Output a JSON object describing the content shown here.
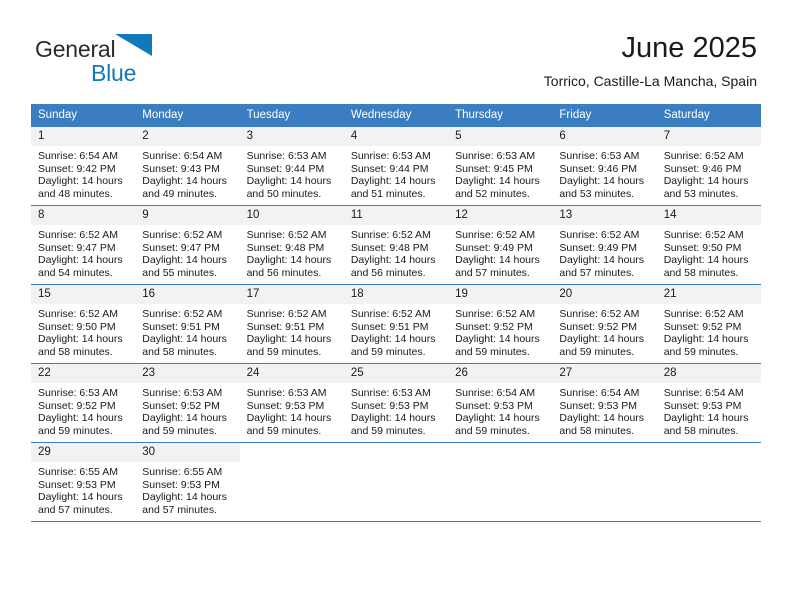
{
  "brand": {
    "name_part1": "General",
    "name_part2": "Blue",
    "triangle_icon": "brand-triangle-icon",
    "color_dark": "#2b2b2b",
    "color_blue": "#1278be"
  },
  "header": {
    "title": "June 2025",
    "subtitle": "Torrico, Castille-La Mancha, Spain"
  },
  "theme": {
    "header_bg": "#3a7dc0",
    "daynum_bg": "#f2f2f2",
    "text": "#1a1a1a"
  },
  "weekday_headers": [
    "Sunday",
    "Monday",
    "Tuesday",
    "Wednesday",
    "Thursday",
    "Friday",
    "Saturday"
  ],
  "weeks": [
    [
      {
        "day": "1",
        "sunrise": "Sunrise: 6:54 AM",
        "sunset": "Sunset: 9:42 PM",
        "daylight1": "Daylight: 14 hours",
        "daylight2": "and 48 minutes."
      },
      {
        "day": "2",
        "sunrise": "Sunrise: 6:54 AM",
        "sunset": "Sunset: 9:43 PM",
        "daylight1": "Daylight: 14 hours",
        "daylight2": "and 49 minutes."
      },
      {
        "day": "3",
        "sunrise": "Sunrise: 6:53 AM",
        "sunset": "Sunset: 9:44 PM",
        "daylight1": "Daylight: 14 hours",
        "daylight2": "and 50 minutes."
      },
      {
        "day": "4",
        "sunrise": "Sunrise: 6:53 AM",
        "sunset": "Sunset: 9:44 PM",
        "daylight1": "Daylight: 14 hours",
        "daylight2": "and 51 minutes."
      },
      {
        "day": "5",
        "sunrise": "Sunrise: 6:53 AM",
        "sunset": "Sunset: 9:45 PM",
        "daylight1": "Daylight: 14 hours",
        "daylight2": "and 52 minutes."
      },
      {
        "day": "6",
        "sunrise": "Sunrise: 6:53 AM",
        "sunset": "Sunset: 9:46 PM",
        "daylight1": "Daylight: 14 hours",
        "daylight2": "and 53 minutes."
      },
      {
        "day": "7",
        "sunrise": "Sunrise: 6:52 AM",
        "sunset": "Sunset: 9:46 PM",
        "daylight1": "Daylight: 14 hours",
        "daylight2": "and 53 minutes."
      }
    ],
    [
      {
        "day": "8",
        "sunrise": "Sunrise: 6:52 AM",
        "sunset": "Sunset: 9:47 PM",
        "daylight1": "Daylight: 14 hours",
        "daylight2": "and 54 minutes."
      },
      {
        "day": "9",
        "sunrise": "Sunrise: 6:52 AM",
        "sunset": "Sunset: 9:47 PM",
        "daylight1": "Daylight: 14 hours",
        "daylight2": "and 55 minutes."
      },
      {
        "day": "10",
        "sunrise": "Sunrise: 6:52 AM",
        "sunset": "Sunset: 9:48 PM",
        "daylight1": "Daylight: 14 hours",
        "daylight2": "and 56 minutes."
      },
      {
        "day": "11",
        "sunrise": "Sunrise: 6:52 AM",
        "sunset": "Sunset: 9:48 PM",
        "daylight1": "Daylight: 14 hours",
        "daylight2": "and 56 minutes."
      },
      {
        "day": "12",
        "sunrise": "Sunrise: 6:52 AM",
        "sunset": "Sunset: 9:49 PM",
        "daylight1": "Daylight: 14 hours",
        "daylight2": "and 57 minutes."
      },
      {
        "day": "13",
        "sunrise": "Sunrise: 6:52 AM",
        "sunset": "Sunset: 9:49 PM",
        "daylight1": "Daylight: 14 hours",
        "daylight2": "and 57 minutes."
      },
      {
        "day": "14",
        "sunrise": "Sunrise: 6:52 AM",
        "sunset": "Sunset: 9:50 PM",
        "daylight1": "Daylight: 14 hours",
        "daylight2": "and 58 minutes."
      }
    ],
    [
      {
        "day": "15",
        "sunrise": "Sunrise: 6:52 AM",
        "sunset": "Sunset: 9:50 PM",
        "daylight1": "Daylight: 14 hours",
        "daylight2": "and 58 minutes."
      },
      {
        "day": "16",
        "sunrise": "Sunrise: 6:52 AM",
        "sunset": "Sunset: 9:51 PM",
        "daylight1": "Daylight: 14 hours",
        "daylight2": "and 58 minutes."
      },
      {
        "day": "17",
        "sunrise": "Sunrise: 6:52 AM",
        "sunset": "Sunset: 9:51 PM",
        "daylight1": "Daylight: 14 hours",
        "daylight2": "and 59 minutes."
      },
      {
        "day": "18",
        "sunrise": "Sunrise: 6:52 AM",
        "sunset": "Sunset: 9:51 PM",
        "daylight1": "Daylight: 14 hours",
        "daylight2": "and 59 minutes."
      },
      {
        "day": "19",
        "sunrise": "Sunrise: 6:52 AM",
        "sunset": "Sunset: 9:52 PM",
        "daylight1": "Daylight: 14 hours",
        "daylight2": "and 59 minutes."
      },
      {
        "day": "20",
        "sunrise": "Sunrise: 6:52 AM",
        "sunset": "Sunset: 9:52 PM",
        "daylight1": "Daylight: 14 hours",
        "daylight2": "and 59 minutes."
      },
      {
        "day": "21",
        "sunrise": "Sunrise: 6:52 AM",
        "sunset": "Sunset: 9:52 PM",
        "daylight1": "Daylight: 14 hours",
        "daylight2": "and 59 minutes."
      }
    ],
    [
      {
        "day": "22",
        "sunrise": "Sunrise: 6:53 AM",
        "sunset": "Sunset: 9:52 PM",
        "daylight1": "Daylight: 14 hours",
        "daylight2": "and 59 minutes."
      },
      {
        "day": "23",
        "sunrise": "Sunrise: 6:53 AM",
        "sunset": "Sunset: 9:52 PM",
        "daylight1": "Daylight: 14 hours",
        "daylight2": "and 59 minutes."
      },
      {
        "day": "24",
        "sunrise": "Sunrise: 6:53 AM",
        "sunset": "Sunset: 9:53 PM",
        "daylight1": "Daylight: 14 hours",
        "daylight2": "and 59 minutes."
      },
      {
        "day": "25",
        "sunrise": "Sunrise: 6:53 AM",
        "sunset": "Sunset: 9:53 PM",
        "daylight1": "Daylight: 14 hours",
        "daylight2": "and 59 minutes."
      },
      {
        "day": "26",
        "sunrise": "Sunrise: 6:54 AM",
        "sunset": "Sunset: 9:53 PM",
        "daylight1": "Daylight: 14 hours",
        "daylight2": "and 59 minutes."
      },
      {
        "day": "27",
        "sunrise": "Sunrise: 6:54 AM",
        "sunset": "Sunset: 9:53 PM",
        "daylight1": "Daylight: 14 hours",
        "daylight2": "and 58 minutes."
      },
      {
        "day": "28",
        "sunrise": "Sunrise: 6:54 AM",
        "sunset": "Sunset: 9:53 PM",
        "daylight1": "Daylight: 14 hours",
        "daylight2": "and 58 minutes."
      }
    ],
    [
      {
        "day": "29",
        "sunrise": "Sunrise: 6:55 AM",
        "sunset": "Sunset: 9:53 PM",
        "daylight1": "Daylight: 14 hours",
        "daylight2": "and 57 minutes."
      },
      {
        "day": "30",
        "sunrise": "Sunrise: 6:55 AM",
        "sunset": "Sunset: 9:53 PM",
        "daylight1": "Daylight: 14 hours",
        "daylight2": "and 57 minutes."
      },
      {
        "day": "",
        "sunrise": "",
        "sunset": "",
        "daylight1": "",
        "daylight2": ""
      },
      {
        "day": "",
        "sunrise": "",
        "sunset": "",
        "daylight1": "",
        "daylight2": ""
      },
      {
        "day": "",
        "sunrise": "",
        "sunset": "",
        "daylight1": "",
        "daylight2": ""
      },
      {
        "day": "",
        "sunrise": "",
        "sunset": "",
        "daylight1": "",
        "daylight2": ""
      },
      {
        "day": "",
        "sunrise": "",
        "sunset": "",
        "daylight1": "",
        "daylight2": ""
      }
    ]
  ]
}
